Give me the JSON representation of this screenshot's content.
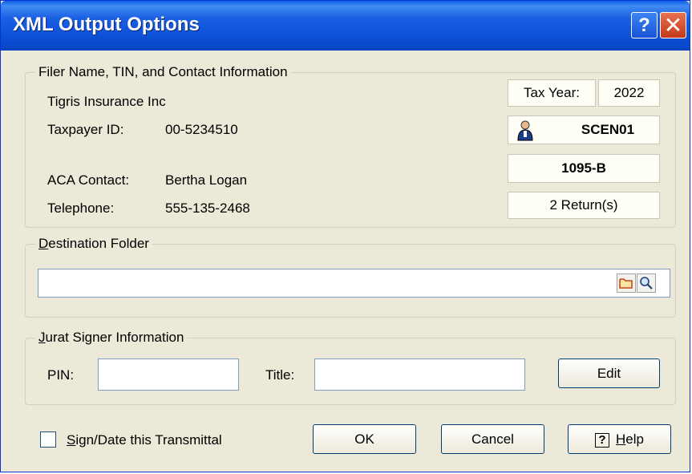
{
  "window": {
    "title": "XML Output Options",
    "help_glyph": "?",
    "close_glyph": "✕"
  },
  "filer": {
    "legend": "Filer Name, TIN, and Contact Information",
    "name": "Tigris Insurance Inc",
    "taxpayer_id_label": "Taxpayer ID:",
    "taxpayer_id": "00-5234510",
    "aca_contact_label": "ACA Contact:",
    "aca_contact": "Bertha Logan",
    "telephone_label": "Telephone:",
    "telephone": "555-135-2468",
    "tax_year_label": "Tax Year:",
    "tax_year": "2022",
    "user_code": "SCEN01",
    "form": "1095-B",
    "returns": "2 Return(s)"
  },
  "destination": {
    "legend_ul": "D",
    "legend_rest": "estination Folder",
    "path": "",
    "folder_icon": "folder-icon",
    "search_icon": "magnifier-icon"
  },
  "jurat": {
    "legend_ul": "J",
    "legend_rest": "urat Signer Information",
    "pin_label": "PIN:",
    "pin_value": "",
    "title_label": "Title:",
    "title_value": "",
    "edit_label": "Edit"
  },
  "footer": {
    "sign_ul": "S",
    "sign_rest": "ign/Date this Transmittal",
    "sign_checked": false,
    "ok_label": "OK",
    "cancel_label": "Cancel",
    "help_glyph": "?",
    "help_ul": "H",
    "help_rest": "elp"
  },
  "colors": {
    "titlebar": "#0a4fd6",
    "face": "#ece9d8",
    "close": "#d9542c"
  }
}
